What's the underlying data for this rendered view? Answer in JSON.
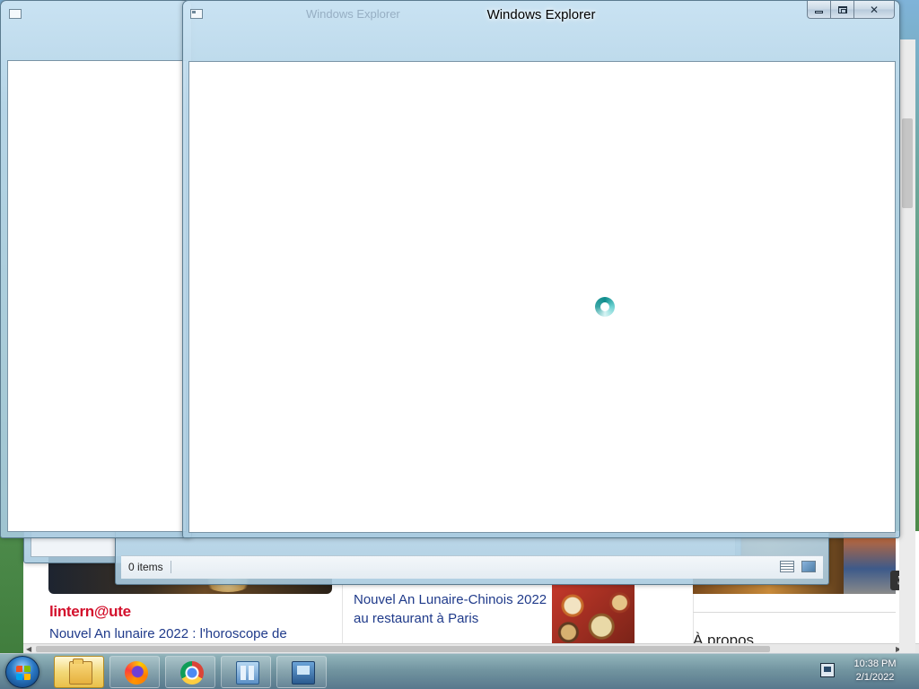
{
  "background_page": {
    "brand": "lintern@ute",
    "headline_left": "Nouvel An lunaire 2022 : l'horoscope de",
    "headline_mid": "Nouvel An Lunaire-Chinois 2022 au restaurant à Paris",
    "sidebar_heading": "À propos"
  },
  "windows": {
    "front": {
      "title": "Windows Explorer",
      "ghost_title": "Windows Explorer"
    },
    "status": {
      "items_count": "0 items"
    }
  },
  "taskbar": {
    "pinned": [
      "start-menu",
      "windows-explorer",
      "firefox",
      "chrome",
      "control-panel",
      "remote-desktop"
    ],
    "clock_time": "10:38 PM",
    "clock_date": "2/1/2022"
  },
  "colors": {
    "brand_red": "#d3102c",
    "link_blue": "#1f3a8a",
    "busy_teal": "#0e8c8c"
  }
}
